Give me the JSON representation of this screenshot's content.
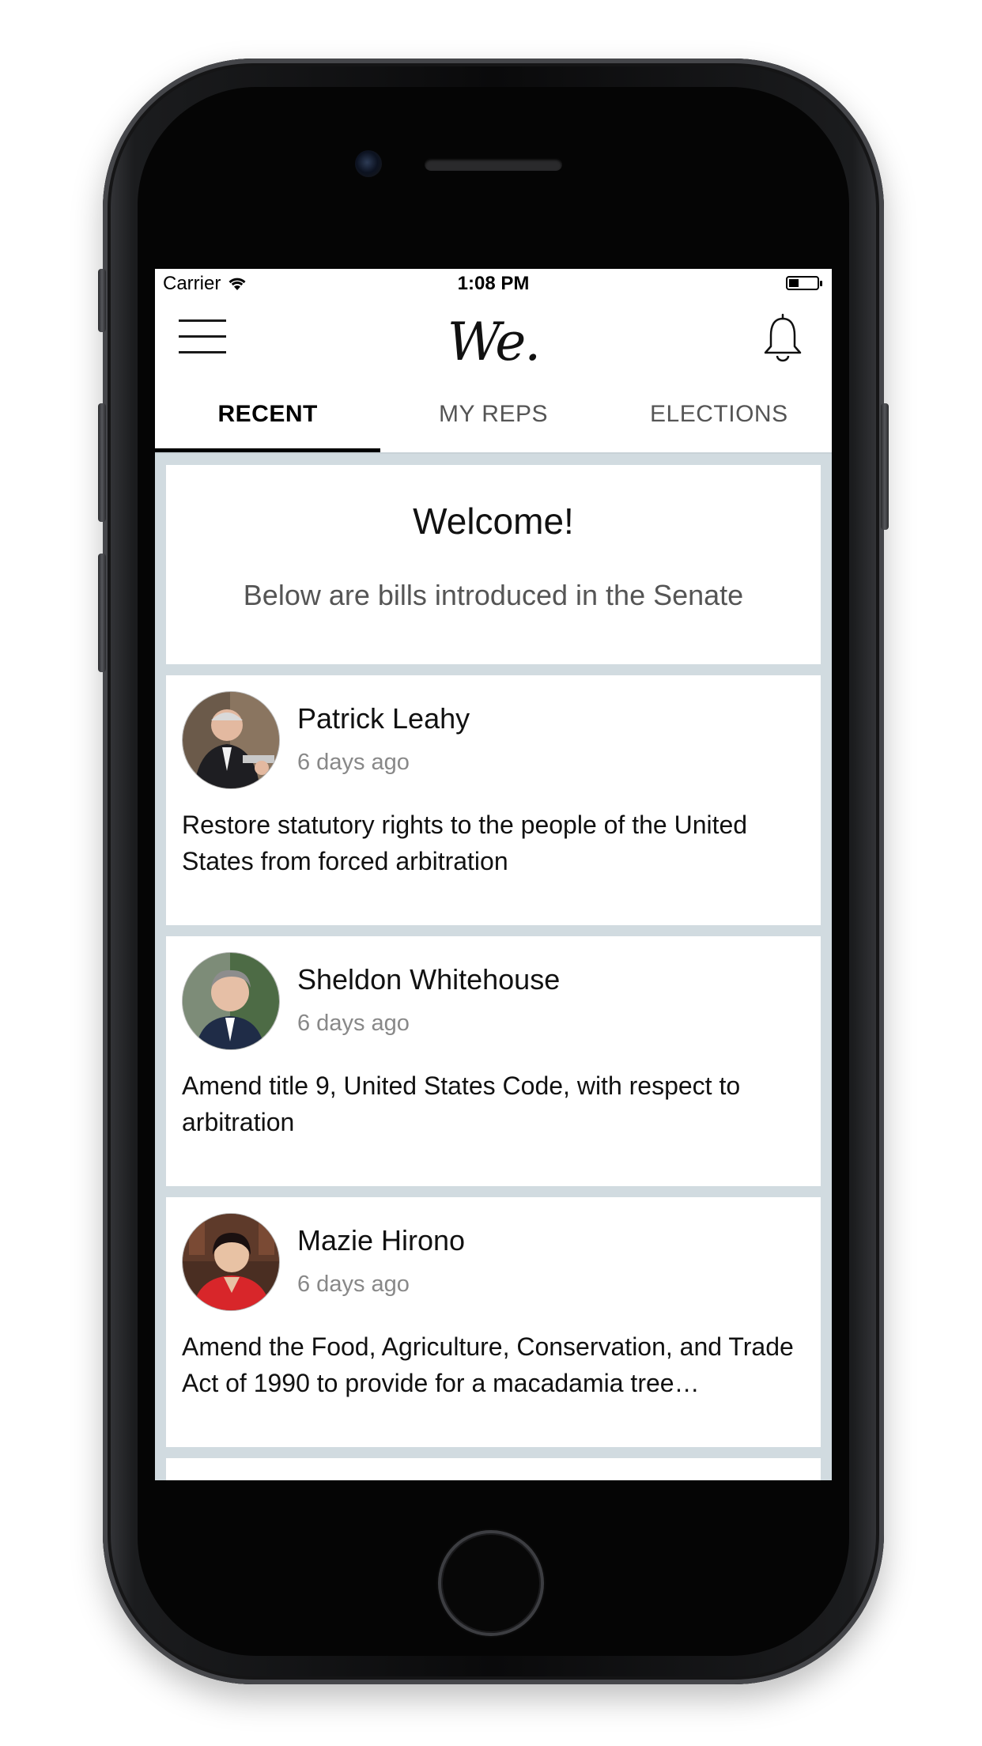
{
  "status_bar": {
    "carrier": "Carrier",
    "time": "1:08 PM"
  },
  "nav": {
    "logo": "We.",
    "menu_icon": "hamburger-menu-icon",
    "bell_icon": "bell-icon"
  },
  "tabs": [
    {
      "label": "RECENT",
      "active": true
    },
    {
      "label": "MY REPS",
      "active": false
    },
    {
      "label": "ELECTIONS",
      "active": false
    }
  ],
  "welcome": {
    "title": "Welcome!",
    "subtitle": "Below are bills introduced in the Senate"
  },
  "bills": [
    {
      "sponsor": "Patrick Leahy",
      "date": "6 days ago",
      "title": "Restore statutory rights to the people of the United States from forced arbitration"
    },
    {
      "sponsor": "Sheldon Whitehouse",
      "date": "6 days ago",
      "title": "Amend title 9, United States Code, with respect to arbitration"
    },
    {
      "sponsor": "Mazie Hirono",
      "date": "6 days ago",
      "title": "Amend the Food, Agriculture, Conservation, and Trade Act of 1990 to provide for a macadamia tree…"
    }
  ],
  "colors": {
    "background": "#d1dbe0",
    "card": "#ffffff",
    "accent": "#000000",
    "muted_text": "#888888"
  }
}
